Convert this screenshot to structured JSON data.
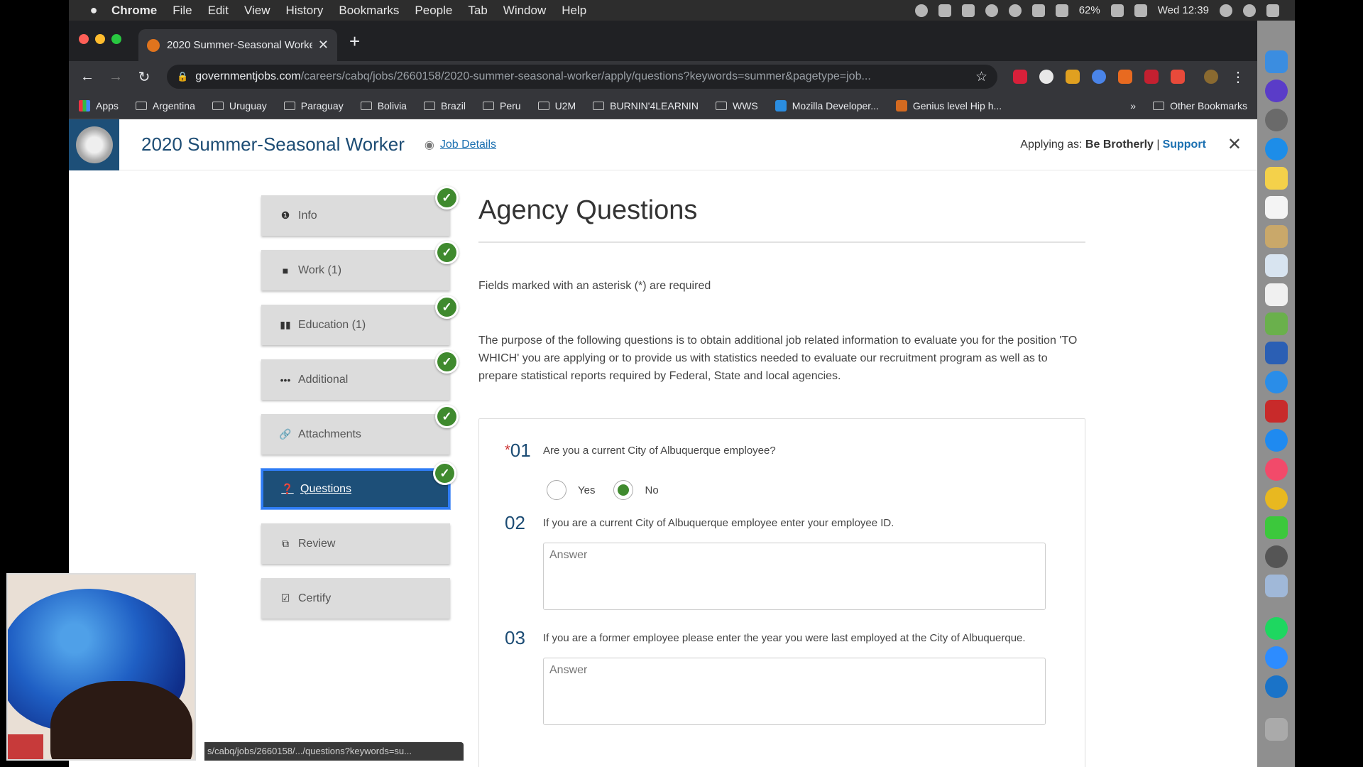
{
  "menubar": {
    "app": "Chrome",
    "items": [
      "File",
      "Edit",
      "View",
      "History",
      "Bookmarks",
      "People",
      "Tab",
      "Window",
      "Help"
    ],
    "battery": "62%",
    "clock": "Wed 12:39"
  },
  "tab": {
    "title": "2020 Summer-Seasonal Worke"
  },
  "address": {
    "host": "governmentjobs.com",
    "path": "/careers/cabq/jobs/2660158/2020-summer-seasonal-worker/apply/questions?keywords=summer&pagetype=job..."
  },
  "bookmarks": {
    "items": [
      "Apps",
      "Argentina",
      "Uruguay",
      "Paraguay",
      "Bolivia",
      "Brazil",
      "Peru",
      "U2M",
      "BURNIN'4LEARNIN",
      "WWS",
      "Mozilla Developer...",
      "Genius level Hip h..."
    ],
    "more": "»",
    "other": "Other Bookmarks"
  },
  "header": {
    "job_title": "2020 Summer-Seasonal Worker",
    "job_details": "Job Details",
    "applying_as_label": "Applying as:",
    "applicant": "Be Brotherly",
    "separator": "|",
    "support": "Support"
  },
  "steps": [
    {
      "label": "Info",
      "icon": "info-icon",
      "glyph": "❶",
      "complete": true
    },
    {
      "label": "Work (1)",
      "icon": "briefcase-icon",
      "glyph": "■",
      "complete": true
    },
    {
      "label": "Education (1)",
      "icon": "book-icon",
      "glyph": "▮▮",
      "complete": true
    },
    {
      "label": "Additional",
      "icon": "ellipsis-icon",
      "glyph": "•••",
      "complete": true
    },
    {
      "label": "Attachments",
      "icon": "paperclip-icon",
      "glyph": "🔗",
      "complete": true
    },
    {
      "label": "Questions",
      "icon": "question-icon",
      "glyph": "❓",
      "complete": true,
      "active": true
    },
    {
      "label": "Review",
      "icon": "review-icon",
      "glyph": "⧉",
      "complete": false
    },
    {
      "label": "Certify",
      "icon": "certify-icon",
      "glyph": "☑",
      "complete": false
    }
  ],
  "main": {
    "title": "Agency Questions",
    "required_note": "Fields marked with an asterisk (*) are required",
    "purpose": "The purpose of the following questions is to obtain additional job related information to evaluate you for the position 'TO WHICH' you are applying or to provide us with statistics needed to evaluate our recruitment program as well as to prepare statistical reports required by Federal, State and local agencies."
  },
  "questions": [
    {
      "num": "01",
      "required": "*",
      "text": "Are you a current City of Albuquerque employee?",
      "options": [
        "Yes",
        "No"
      ],
      "selected": "No"
    },
    {
      "num": "02",
      "text": "If you are a current City of Albuquerque employee enter your employee ID.",
      "placeholder": "Answer"
    },
    {
      "num": "03",
      "text": "If you are a former employee please enter the year you were last employed at the City of Albuquerque.",
      "placeholder": "Answer"
    }
  ],
  "status_url": "s/cabq/jobs/2660158/.../questions?keywords=su...",
  "colors": {
    "brand": "#1d4f78",
    "check": "#3f8a2e",
    "link": "#1b70b1"
  }
}
